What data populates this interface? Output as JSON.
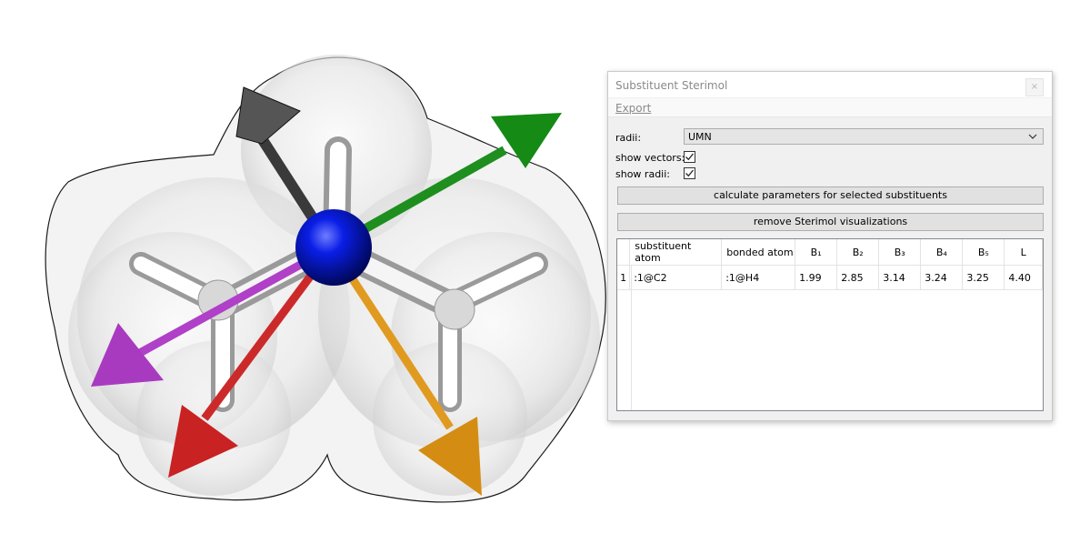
{
  "dialog": {
    "title": "Substituent Sterimol",
    "close_label": "×",
    "menu": {
      "export_label": "Export"
    },
    "radii_label": "radii:",
    "radii_value": "UMN",
    "show_vectors_label": "show vectors:",
    "show_vectors_checked": true,
    "show_radii_label": "show radii:",
    "show_radii_checked": true,
    "calculate_button": "calculate parameters for selected substituents",
    "remove_button": "remove Sterimol visualizations",
    "table": {
      "headers": [
        "substituent atom",
        "bonded atom",
        "B₁",
        "B₂",
        "B₃",
        "B₄",
        "B₅",
        "L"
      ],
      "rows": [
        {
          "index": "1",
          "cells": [
            ":1@C2",
            ":1@H4",
            "1.99",
            "2.85",
            "3.14",
            "3.24",
            "3.25",
            "4.40"
          ]
        }
      ]
    }
  },
  "scene": {
    "central_atom_color": "#0010d8",
    "vector_colors": {
      "black": "#3a3a3a",
      "green": "#1e8f1e",
      "purple": "#b040c8",
      "red": "#cc2a2a",
      "orange": "#e09a20"
    }
  }
}
